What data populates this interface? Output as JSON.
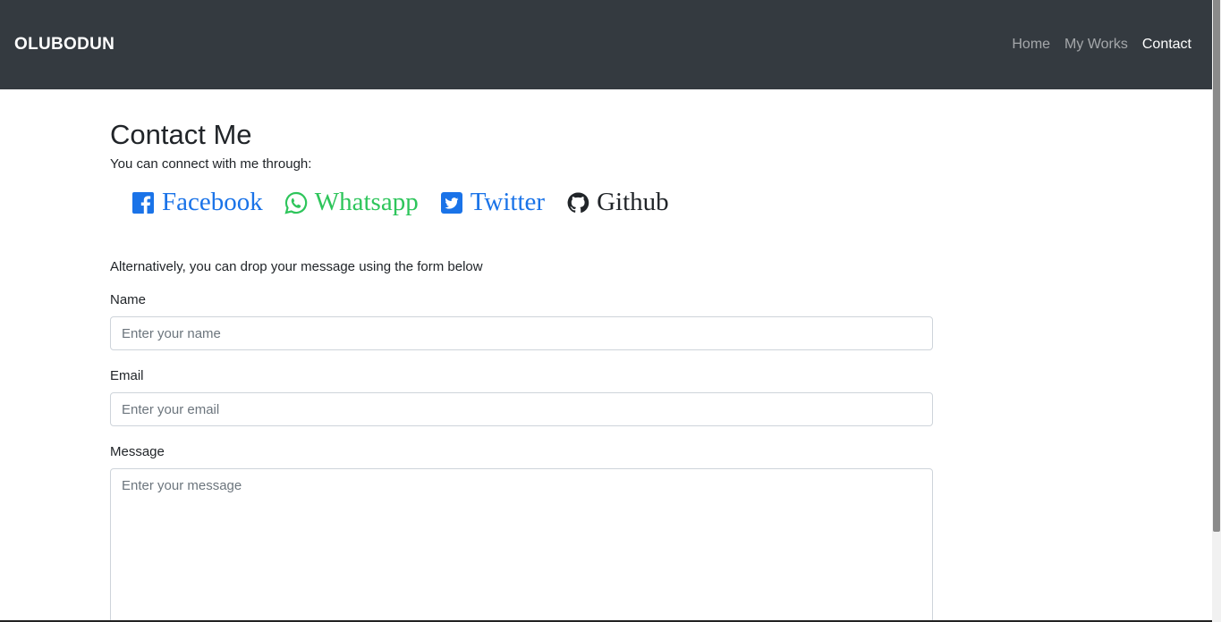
{
  "navbar": {
    "brand": "OLUBODUN",
    "links": [
      {
        "label": "Home",
        "active": false
      },
      {
        "label": "My Works",
        "active": false
      },
      {
        "label": "Contact",
        "active": true
      }
    ]
  },
  "page": {
    "title": "Contact Me",
    "intro": "You can connect with me through:",
    "alternative": "Alternatively, you can drop your message using the form below"
  },
  "social": [
    {
      "label": "Facebook",
      "icon": "facebook-square-icon",
      "color": "#1a73e8"
    },
    {
      "label": "Whatsapp",
      "icon": "whatsapp-icon",
      "color": "#2ec55b"
    },
    {
      "label": "Twitter",
      "icon": "twitter-square-icon",
      "color": "#1a73e8"
    },
    {
      "label": "Github",
      "icon": "github-icon",
      "color": "#212529"
    }
  ],
  "form": {
    "name": {
      "label": "Name",
      "placeholder": "Enter your name",
      "value": ""
    },
    "email": {
      "label": "Email",
      "placeholder": "Enter your email",
      "value": ""
    },
    "message": {
      "label": "Message",
      "placeholder": "Enter your message",
      "value": ""
    }
  },
  "colors": {
    "navbar_bg": "#343a40",
    "link_blue": "#1a73e8",
    "whatsapp_green": "#2ec55b"
  }
}
